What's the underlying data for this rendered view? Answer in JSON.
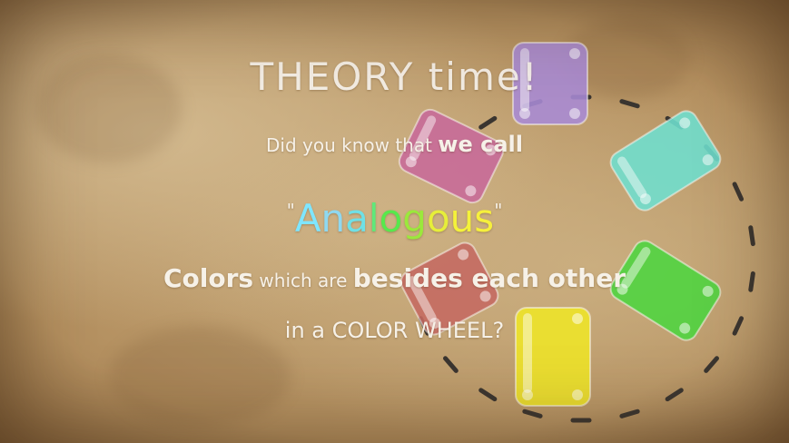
{
  "slide": {
    "title": "THEORY time!",
    "line1": {
      "part1": "Did you know that ",
      "part2": "we call"
    },
    "line2": {
      "open_quote": "\"",
      "letters": [
        {
          "char": "A",
          "color": "#7fe6ff"
        },
        {
          "char": "n",
          "color": "#8fd8f0"
        },
        {
          "char": "a",
          "color": "#6fe0e6"
        },
        {
          "char": "l",
          "color": "#5fe87a"
        },
        {
          "char": "o",
          "color": "#57e84c"
        },
        {
          "char": "g",
          "color": "#9be83c"
        },
        {
          "char": "o",
          "color": "#e6ee3a"
        },
        {
          "char": "u",
          "color": "#f4f23a"
        },
        {
          "char": "s",
          "color": "#f6f03c"
        }
      ],
      "close_quote": "\""
    },
    "line3": {
      "w1": "Colors",
      "w2": " which are ",
      "w3": "besides ",
      "w4": "each other"
    },
    "line4": "in a COLOR WHEEL?"
  },
  "wheel": {
    "blocks": [
      {
        "name": "purple",
        "color": "#a98bd6"
      },
      {
        "name": "teal",
        "color": "#6fe0d0"
      },
      {
        "name": "green",
        "color": "#4ed640"
      },
      {
        "name": "yellow",
        "color": "#f0e628"
      },
      {
        "name": "red",
        "color": "#c56a62"
      },
      {
        "name": "magenta",
        "color": "#c86a9a"
      }
    ],
    "dash_color": "#3a3530"
  }
}
